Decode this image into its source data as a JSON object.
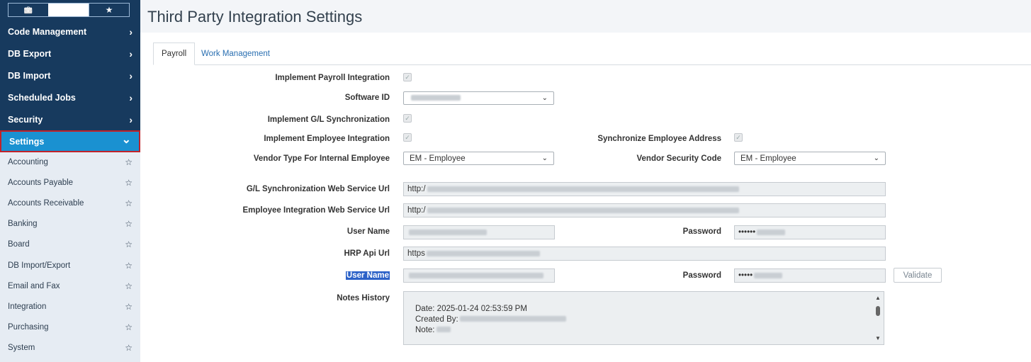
{
  "sidebar": {
    "tabs": [
      {
        "icon": "briefcase-icon",
        "glyph": "💼"
      },
      {
        "icon": "wrench-icon",
        "glyph": "🔧"
      },
      {
        "icon": "star-icon",
        "glyph": "★"
      }
    ],
    "nav": [
      {
        "label": "Code Management",
        "chevron": "›"
      },
      {
        "label": "DB Export",
        "chevron": "›"
      },
      {
        "label": "DB Import",
        "chevron": "›"
      },
      {
        "label": "Scheduled Jobs",
        "chevron": "›"
      },
      {
        "label": "Security",
        "chevron": "›"
      },
      {
        "label": "Settings",
        "chevron": "⌄"
      }
    ],
    "sub": [
      {
        "label": "Accounting",
        "star": "☆"
      },
      {
        "label": "Accounts Payable",
        "star": "☆"
      },
      {
        "label": "Accounts Receivable",
        "star": "☆"
      },
      {
        "label": "Banking",
        "star": "☆"
      },
      {
        "label": "Board",
        "star": "☆"
      },
      {
        "label": "DB Import/Export",
        "star": "☆"
      },
      {
        "label": "Email and Fax",
        "star": "☆"
      },
      {
        "label": "Integration",
        "star": "☆"
      },
      {
        "label": "Purchasing",
        "star": "☆"
      },
      {
        "label": "System",
        "star": "☆"
      }
    ]
  },
  "page": {
    "title": "Third Party Integration Settings"
  },
  "tabs": [
    {
      "label": "Payroll"
    },
    {
      "label": "Work Management"
    }
  ],
  "form": {
    "implement_payroll": {
      "label": "Implement Payroll Integration",
      "check": "✓"
    },
    "software_id": {
      "label": "Software ID",
      "caret": "⌄"
    },
    "implement_gl": {
      "label": "Implement G/L Synchronization",
      "check": "✓"
    },
    "implement_employee": {
      "label": "Implement Employee Integration",
      "check": "✓"
    },
    "sync_address": {
      "label": "Synchronize Employee Address",
      "check": "✓"
    },
    "vendor_type": {
      "label": "Vendor Type For Internal Employee",
      "value": "EM - Employee",
      "caret": "⌄"
    },
    "vendor_security": {
      "label": "Vendor Security Code",
      "value": "EM - Employee",
      "caret": "⌄"
    },
    "gl_url": {
      "label": "G/L Synchronization Web Service Url",
      "value": "http:/"
    },
    "emp_url": {
      "label": "Employee Integration Web Service Url",
      "value": "http:/"
    },
    "user_name_1": {
      "label": "User Name"
    },
    "password_1": {
      "label": "Password",
      "value": "••••••"
    },
    "hrp_url": {
      "label": "HRP Api Url",
      "value": "https"
    },
    "user_name_2": {
      "label": "User Name"
    },
    "password_2": {
      "label": "Password",
      "value": "•••••"
    },
    "validate": {
      "label": "Validate"
    },
    "notes": {
      "label": "Notes History",
      "date": "Date: 2025-01-24 02:53:59 PM",
      "created_by": "Created By:",
      "note": "Note:",
      "scroll_up": "▲",
      "scroll_down": "▼"
    }
  },
  "colors": {
    "sidebar_dark": "#173a5e",
    "accent": "#1a91d1",
    "highlight_border": "#c0222a"
  }
}
